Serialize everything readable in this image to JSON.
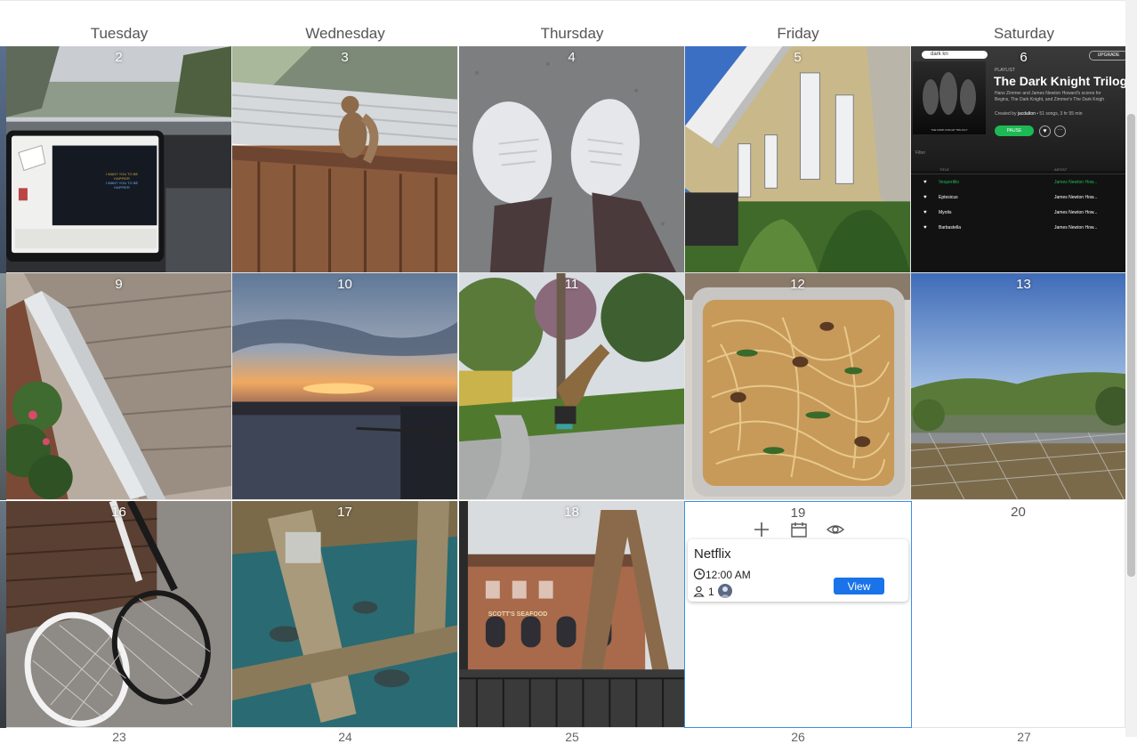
{
  "weekdays": [
    "Tuesday",
    "Wednesday",
    "Thursday",
    "Friday",
    "Saturday"
  ],
  "row1": [
    "2",
    "3",
    "4",
    "5",
    "6"
  ],
  "row2": [
    "9",
    "10",
    "11",
    "12",
    "13"
  ],
  "row3": [
    "16",
    "17",
    "18",
    "19",
    "20"
  ],
  "row4_partial": [
    "23",
    "24",
    "25",
    "26",
    "27"
  ],
  "tesla_screen": {
    "line1": "I WANT YOU TO BE",
    "line2": "HAPPIER",
    "line3": "I WANT YOU TO BE",
    "line4": "HAPPIER"
  },
  "spotify": {
    "search": "dark kn",
    "upgrade": "UPGRADE",
    "type": "PLAYLIST",
    "title": "The Dark Knight Trilog",
    "desc1": "Hans Zimmer and James Newton Howard's scores for",
    "desc2": "Begins, The Dark Knight, and Zimmer's The Dark Knigh",
    "created_by_prefix": "Created by",
    "created_by": "jacdalton",
    "meta": "• 51 songs, 3 hr 55 min",
    "pause": "PAUSE",
    "filter": "Filter",
    "col_title": "TITLE",
    "col_artist": "ARTIST",
    "album_text": "THE DARK KNIGHT TRILOGY",
    "tracks": [
      {
        "title": "Vespertilio",
        "artist": "James Newton How..."
      },
      {
        "title": "Eptesicus",
        "artist": "James Newton How..."
      },
      {
        "title": "Myotis",
        "artist": "James Newton How..."
      },
      {
        "title": "Barbastella",
        "artist": "James Newton How..."
      }
    ]
  },
  "sign_text": "SCOTT'S SEAFOOD",
  "event": {
    "title": "Netflix",
    "time": "12:00 AM",
    "attendee_count": "1",
    "view_label": "View"
  },
  "icons": {
    "add": "plus-icon",
    "calendar": "calendar-icon",
    "view": "eye-icon",
    "clock": "clock-icon",
    "person": "person-icon"
  },
  "colors": {
    "accent": "#1a73e8",
    "selected_border": "#3a8ee6",
    "spotify_green": "#1db954"
  }
}
